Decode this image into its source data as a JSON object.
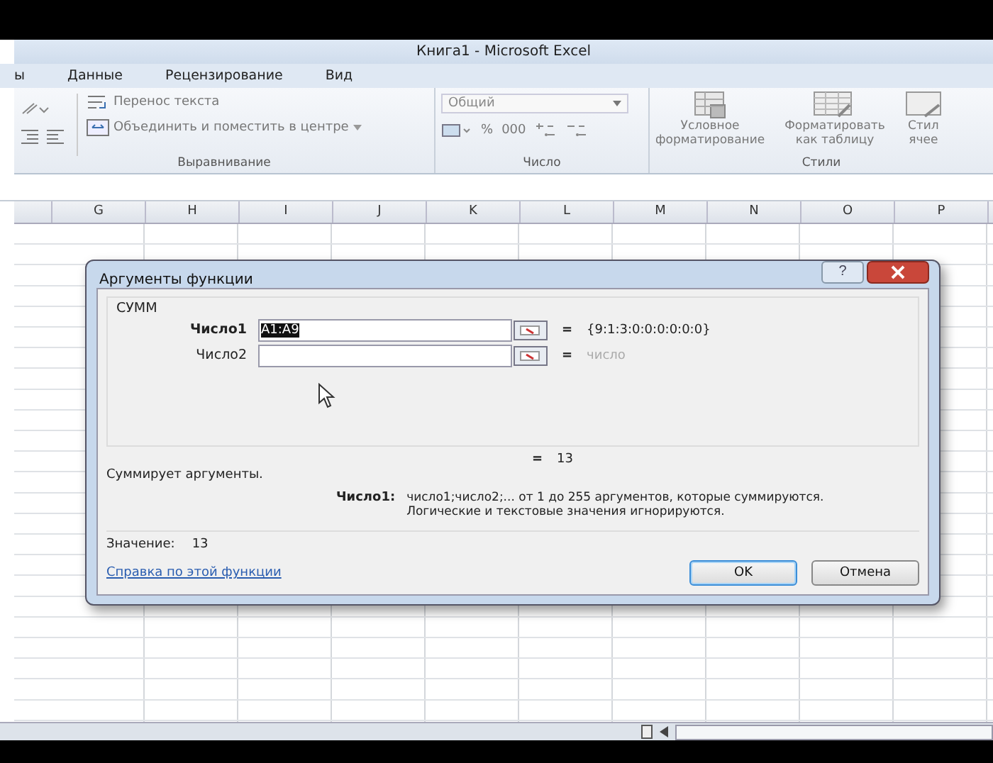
{
  "window": {
    "title": "Книга1 - Microsoft Excel"
  },
  "ribbon_tabs": [
    {
      "label": "ы",
      "selected": false
    },
    {
      "label": "Данные",
      "selected": false
    },
    {
      "label": "Рецензирование",
      "selected": false
    },
    {
      "label": "Вид",
      "selected": false
    }
  ],
  "ribbon": {
    "alignment": {
      "wrap_text": "Перенос текста",
      "merge": "Объединить и поместить в центре",
      "label": "Выравнивание"
    },
    "number": {
      "format": "Общий",
      "percent": "%",
      "thousands": "000",
      "label": "Число"
    },
    "styles": {
      "conditional": [
        "Условное",
        "форматирование"
      ],
      "as_table": [
        "Форматировать",
        "как таблицу"
      ],
      "cell_styles": [
        "Стил",
        "ячее"
      ],
      "label": "Стили"
    }
  },
  "columns": [
    "G",
    "H",
    "I",
    "J",
    "K",
    "L",
    "M",
    "N",
    "O",
    "P"
  ],
  "dialog": {
    "title": "Аргументы функции",
    "function": "СУММ",
    "arguments": [
      {
        "label": "Число1",
        "required": true,
        "value": "A1:A9",
        "value_selected": true,
        "sign": "=",
        "result": "{9:1:3:0:0:0:0:0:0}",
        "result_greyed": false
      },
      {
        "label": "Число2",
        "required": false,
        "sign": "=",
        "result": "число",
        "result_greyed": true
      }
    ],
    "help_button": "?",
    "total_sign": "=",
    "total": "13",
    "description": "Суммирует аргументы.",
    "arg_help": {
      "label": "Число1:",
      "lines": [
        "число1;число2;... от 1 до 255 аргументов, которые суммируются.",
        "Логические и текстовые значения игнорируются."
      ]
    },
    "value_label": "Значение:",
    "value": "13",
    "help_link": "Справка по этой функции",
    "buttons": [
      {
        "label": "OK",
        "default": true
      },
      {
        "label": "Отмена",
        "default": false
      }
    ]
  }
}
